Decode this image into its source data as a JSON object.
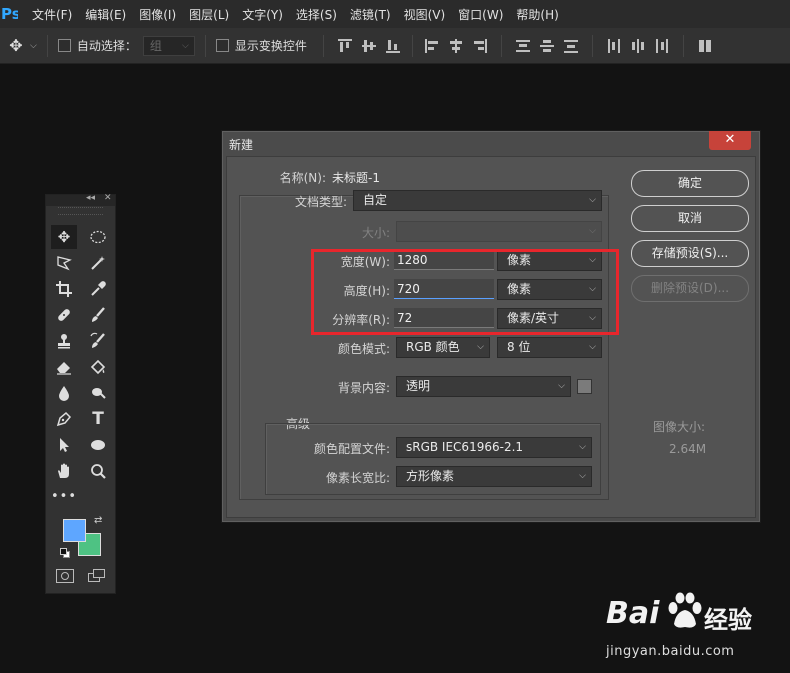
{
  "app": {
    "logo": "Ps"
  },
  "menu": [
    "文件(F)",
    "编辑(E)",
    "图像(I)",
    "图层(L)",
    "文字(Y)",
    "选择(S)",
    "滤镜(T)",
    "视图(V)",
    "窗口(W)",
    "帮助(H)"
  ],
  "options": {
    "auto_select_label": "自动选择：",
    "auto_select_value": "组",
    "show_transform_label": "显示变换控件"
  },
  "dialog": {
    "title": "新建",
    "close": "✕",
    "name_label": "名称(N):",
    "name_value": "未标题-1",
    "doc_type_label": "文档类型:",
    "doc_type_value": "自定",
    "size_label": "大小:",
    "size_value": "",
    "width_label": "宽度(W):",
    "width_value": "1280",
    "width_unit": "像素",
    "height_label": "高度(H):",
    "height_value": "720",
    "height_unit": "像素",
    "resolution_label": "分辨率(R):",
    "resolution_value": "72",
    "resolution_unit": "像素/英寸",
    "color_mode_label": "颜色模式:",
    "color_mode_value": "RGB 颜色",
    "bit_depth_value": "8 位",
    "background_label": "背景内容:",
    "background_value": "透明",
    "advanced_label": "高级",
    "color_profile_label": "颜色配置文件:",
    "color_profile_value": "sRGB IEC61966-2.1",
    "pixel_aspect_label": "像素长宽比:",
    "pixel_aspect_value": "方形像素",
    "image_size_label": "图像大小:",
    "image_size_value": "2.64M",
    "buttons": {
      "ok": "确定",
      "cancel": "取消",
      "save_preset": "存储预设(S)...",
      "delete_preset": "删除预设(D)..."
    }
  },
  "watermark": {
    "brand": "Bai",
    "brand_suffix": "经验",
    "url": "jingyan.baidu.com"
  },
  "colors": {
    "foreground": "#5ea6ff",
    "background": "#4ec283",
    "highlight": "#e8262c"
  }
}
